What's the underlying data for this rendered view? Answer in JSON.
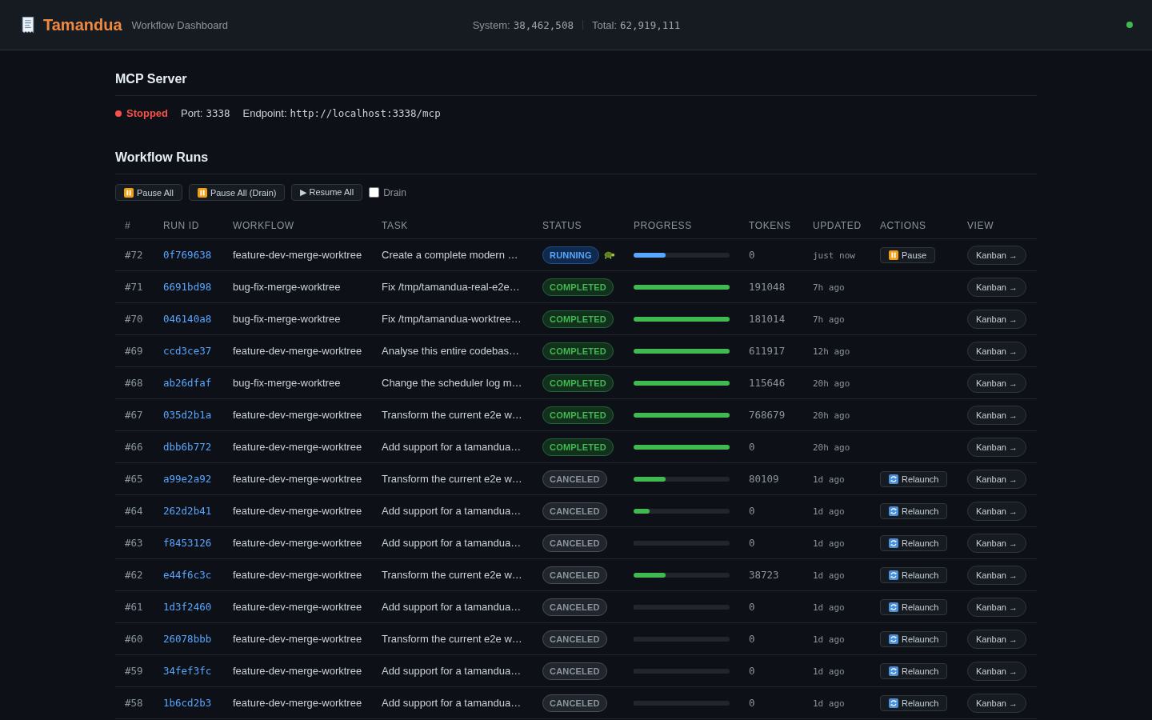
{
  "header": {
    "title": "Tamandua",
    "subtitle": "Workflow Dashboard",
    "stats": [
      {
        "label": "System:",
        "value": "38,462,508"
      },
      {
        "label": "Total:",
        "value": "62,919,111"
      }
    ],
    "connected": true
  },
  "mcp_server": {
    "heading": "MCP Server",
    "running": false,
    "status": "Stopped",
    "port_label": "Port:",
    "port": "3338",
    "endpoint_label": "Endpoint:",
    "endpoint": "http://localhost:3338/mcp"
  },
  "workflow_runs": {
    "heading": "Workflow Runs",
    "toolbar": [
      {
        "label": "Pause All",
        "kind": "pause"
      },
      {
        "label": "Pause All (Drain)",
        "kind": "pause"
      },
      {
        "label": "▶ Resume All",
        "kind": "plain"
      }
    ],
    "drain": {
      "label": "Drain",
      "checked": false
    },
    "columns": [
      "#",
      "RUN ID",
      "WORKFLOW",
      "TASK",
      "STATUS",
      "PROGRESS",
      "TOKENS",
      "UPDATED",
      "ACTIONS",
      "VIEW"
    ],
    "rows": [
      {
        "number": "#72",
        "run_id": "0f769638",
        "workflow": "feature-dev-merge-worktree",
        "task": "Create a complete modern …",
        "status": "RUNNING",
        "kind": "running",
        "status_icon": true,
        "level": 0.33,
        "tokens": "0",
        "updated": "just now",
        "action": {
          "label": "Pause",
          "kind": "pause"
        },
        "view": "Kanban →"
      },
      {
        "number": "#71",
        "run_id": "6691bd98",
        "workflow": "bug-fix-merge-worktree",
        "task": "Fix /tmp/tamandua-real-e2e…",
        "status": "COMPLETED",
        "kind": "completed",
        "status_icon": false,
        "level": 1,
        "tokens": "191048",
        "updated": "7h ago",
        "view": "Kanban →"
      },
      {
        "number": "#70",
        "run_id": "046140a8",
        "workflow": "bug-fix-merge-worktree",
        "task": "Fix /tmp/tamandua-worktree…",
        "status": "COMPLETED",
        "kind": "completed",
        "status_icon": false,
        "level": 1,
        "tokens": "181014",
        "updated": "7h ago",
        "view": "Kanban →"
      },
      {
        "number": "#69",
        "run_id": "ccd3ce37",
        "workflow": "feature-dev-merge-worktree",
        "task": "Analyse this entire codebas…",
        "status": "COMPLETED",
        "kind": "completed",
        "status_icon": false,
        "level": 1,
        "tokens": "611917",
        "updated": "12h ago",
        "view": "Kanban →"
      },
      {
        "number": "#68",
        "run_id": "ab26dfaf",
        "workflow": "bug-fix-merge-worktree",
        "task": "Change the scheduler log m…",
        "status": "COMPLETED",
        "kind": "completed",
        "status_icon": false,
        "level": 1,
        "tokens": "115646",
        "updated": "20h ago",
        "view": "Kanban →"
      },
      {
        "number": "#67",
        "run_id": "035d2b1a",
        "workflow": "feature-dev-merge-worktree",
        "task": "Transform the current e2e w…",
        "status": "COMPLETED",
        "kind": "completed",
        "status_icon": false,
        "level": 1,
        "tokens": "768679",
        "updated": "20h ago",
        "view": "Kanban →"
      },
      {
        "number": "#66",
        "run_id": "dbb6b772",
        "workflow": "feature-dev-merge-worktree",
        "task": "Add support for a tamandua…",
        "status": "COMPLETED",
        "kind": "completed",
        "status_icon": false,
        "level": 1,
        "tokens": "0",
        "updated": "20h ago",
        "view": "Kanban →"
      },
      {
        "number": "#65",
        "run_id": "a99e2a92",
        "workflow": "feature-dev-merge-worktree",
        "task": "Transform the current e2e w…",
        "status": "CANCELED",
        "kind": "canceled",
        "status_icon": false,
        "level": 0.33,
        "tokens": "80109",
        "updated": "1d ago",
        "action": {
          "label": "Relaunch",
          "kind": "relaunch"
        },
        "view": "Kanban →"
      },
      {
        "number": "#64",
        "run_id": "262d2b41",
        "workflow": "feature-dev-merge-worktree",
        "task": "Add support for a tamandua…",
        "status": "CANCELED",
        "kind": "canceled",
        "status_icon": false,
        "level": 0.17,
        "tokens": "0",
        "updated": "1d ago",
        "action": {
          "label": "Relaunch",
          "kind": "relaunch"
        },
        "view": "Kanban →"
      },
      {
        "number": "#63",
        "run_id": "f8453126",
        "workflow": "feature-dev-merge-worktree",
        "task": "Add support for a tamandua…",
        "status": "CANCELED",
        "kind": "canceled",
        "status_icon": false,
        "level": 0,
        "tokens": "0",
        "updated": "1d ago",
        "action": {
          "label": "Relaunch",
          "kind": "relaunch"
        },
        "view": "Kanban →"
      },
      {
        "number": "#62",
        "run_id": "e44f6c3c",
        "workflow": "feature-dev-merge-worktree",
        "task": "Transform the current e2e w…",
        "status": "CANCELED",
        "kind": "canceled",
        "status_icon": false,
        "level": 0.33,
        "tokens": "38723",
        "updated": "1d ago",
        "action": {
          "label": "Relaunch",
          "kind": "relaunch"
        },
        "view": "Kanban →"
      },
      {
        "number": "#61",
        "run_id": "1d3f2460",
        "workflow": "feature-dev-merge-worktree",
        "task": "Add support for a tamandua…",
        "status": "CANCELED",
        "kind": "canceled",
        "status_icon": false,
        "level": 0,
        "tokens": "0",
        "updated": "1d ago",
        "action": {
          "label": "Relaunch",
          "kind": "relaunch"
        },
        "view": "Kanban →"
      },
      {
        "number": "#60",
        "run_id": "26078bbb",
        "workflow": "feature-dev-merge-worktree",
        "task": "Transform the current e2e w…",
        "status": "CANCELED",
        "kind": "canceled",
        "status_icon": false,
        "level": 0,
        "tokens": "0",
        "updated": "1d ago",
        "action": {
          "label": "Relaunch",
          "kind": "relaunch"
        },
        "view": "Kanban →"
      },
      {
        "number": "#59",
        "run_id": "34fef3fc",
        "workflow": "feature-dev-merge-worktree",
        "task": "Add support for a tamandua…",
        "status": "CANCELED",
        "kind": "canceled",
        "status_icon": false,
        "level": 0,
        "tokens": "0",
        "updated": "1d ago",
        "action": {
          "label": "Relaunch",
          "kind": "relaunch"
        },
        "view": "Kanban →"
      },
      {
        "number": "#58",
        "run_id": "1b6cd2b3",
        "workflow": "feature-dev-merge-worktree",
        "task": "Add support for a tamandua…",
        "status": "CANCELED",
        "kind": "canceled",
        "status_icon": false,
        "level": 0,
        "tokens": "0",
        "updated": "1d ago",
        "action": {
          "label": "Relaunch",
          "kind": "relaunch"
        },
        "view": "Kanban →"
      }
    ]
  }
}
